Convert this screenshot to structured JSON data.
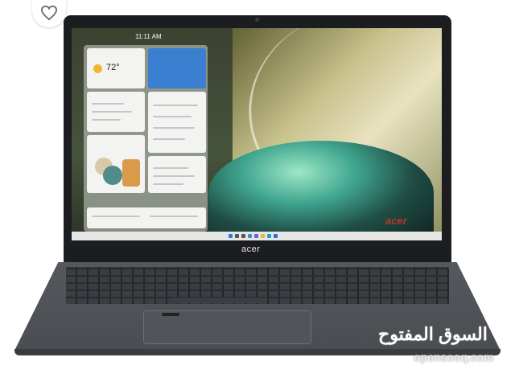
{
  "favorite": {
    "icon": "heart-icon"
  },
  "screen": {
    "clock": "11:11 AM",
    "wallpaper_brand": "acer",
    "widgets": {
      "weather_temp": "72°"
    }
  },
  "laptop": {
    "brand_logo": "acer"
  },
  "watermark": {
    "arabic": "السوق المفتوح",
    "latin": "opensooq.com"
  },
  "colors": {
    "deck": "#4d5055",
    "bezel": "#1c1d20",
    "watermark": "#ffffff"
  }
}
